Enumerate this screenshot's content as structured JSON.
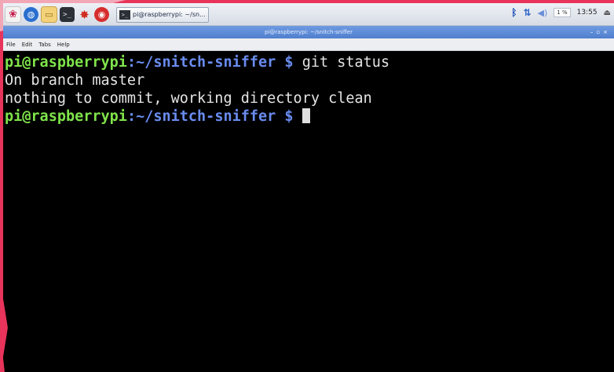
{
  "taskbar": {
    "task_button_label": "pi@raspberrypi: ~/sn...",
    "tray": {
      "cpu": "1 %",
      "clock": "13:55"
    }
  },
  "window": {
    "title": "pi@raspberrypi: ~/snitch-sniffer"
  },
  "menubar": {
    "items": [
      "File",
      "Edit",
      "Tabs",
      "Help"
    ]
  },
  "terminal": {
    "prompt_user": "pi@raspberrypi",
    "prompt_path": ":~/snitch-sniffer $",
    "command": " git status",
    "output_line_1": "On branch master",
    "output_line_2": "nothing to commit, working directory clean"
  },
  "colors": {
    "page_accent": "#e8345a",
    "prompt_user": "#7fe34a",
    "prompt_path": "#6a8cf0",
    "titlebar": "#5a88d6"
  },
  "icons": [
    "raspberry-menu-icon",
    "web-browser-icon",
    "file-manager-icon",
    "terminal-icon",
    "mathematica-icon",
    "wolfram-icon",
    "bluetooth-icon",
    "network-icon",
    "volume-icon",
    "eject-icon"
  ]
}
